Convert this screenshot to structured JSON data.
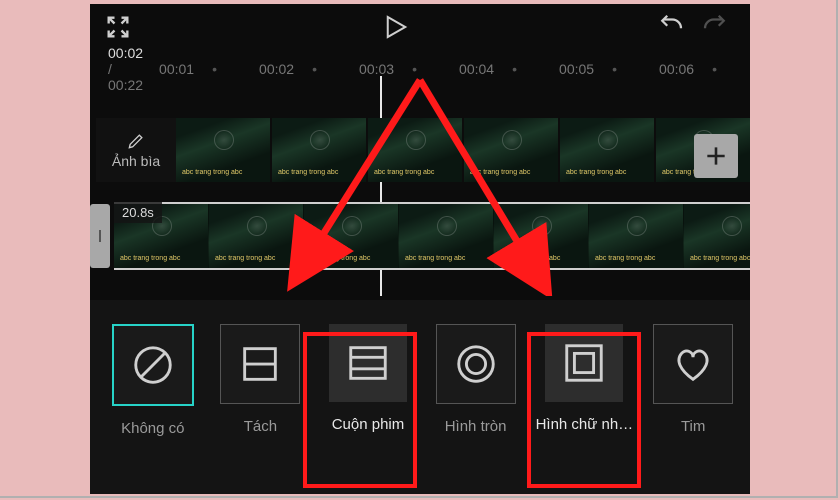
{
  "toolbar": {
    "expand_name": "expand-icon",
    "play_name": "play-icon",
    "undo_name": "undo-icon",
    "redo_name": "redo-icon"
  },
  "ruler": {
    "current": "00:02",
    "total": "00:22",
    "ticks": [
      "00:01",
      "00:02",
      "00:03",
      "00:04",
      "00:05",
      "00:06"
    ]
  },
  "cover": {
    "label": "Ảnh bìa",
    "icon_name": "pencil-icon"
  },
  "add_button_name": "plus-icon",
  "clip": {
    "duration": "20.8s"
  },
  "effects": [
    {
      "id": "none",
      "label": "Không có",
      "icon": "ban",
      "active": true,
      "selected": false
    },
    {
      "id": "split",
      "label": "Tách",
      "icon": "hsplit",
      "active": false,
      "selected": false
    },
    {
      "id": "filmroll",
      "label": "Cuộn phim",
      "icon": "hbars",
      "active": false,
      "selected": true
    },
    {
      "id": "circle",
      "label": "Hình tròn",
      "icon": "ring",
      "active": false,
      "selected": false
    },
    {
      "id": "rect",
      "label": "Hình chữ nh…",
      "icon": "rects",
      "active": false,
      "selected": true
    },
    {
      "id": "heart",
      "label": "Tim",
      "icon": "heart",
      "active": false,
      "selected": false
    }
  ],
  "annotations": {
    "highlight_effects": [
      "filmroll",
      "rect"
    ]
  }
}
